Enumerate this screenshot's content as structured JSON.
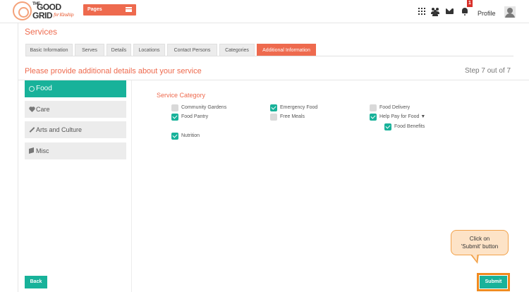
{
  "header": {
    "logo": {
      "line1": "THE",
      "line2": "GOOD",
      "line3": "GRID",
      "tagline": "for Kinship"
    },
    "pages_label": "Pages",
    "notification_count": "1",
    "profile_label": "Profile"
  },
  "page_title": "Services",
  "tabs": [
    {
      "label": "Basic Information",
      "active": false
    },
    {
      "label": "Serves",
      "active": false
    },
    {
      "label": "Details",
      "active": false
    },
    {
      "label": "Locations",
      "active": false
    },
    {
      "label": "Contact Persons",
      "active": false
    },
    {
      "label": "Categories",
      "active": false
    },
    {
      "label": "Additional Information",
      "active": true
    }
  ],
  "subheading": "Please provide additional details about your service",
  "step": "Step 7 out of 7",
  "sidebar": {
    "items": [
      {
        "label": "Food",
        "icon": "food-icon",
        "active": true
      },
      {
        "label": "Care",
        "icon": "heart-icon",
        "active": false
      },
      {
        "label": "Arts and Culture",
        "icon": "brush-icon",
        "active": false
      },
      {
        "label": "Misc",
        "icon": "cube-icon",
        "active": false
      }
    ]
  },
  "service_category": {
    "title": "Service Category",
    "options": [
      {
        "label": "Community Gardens",
        "checked": false
      },
      {
        "label": "Emergency Food",
        "checked": true
      },
      {
        "label": "Food Delivery",
        "checked": false
      },
      {
        "label": "Food Pantry",
        "checked": true
      },
      {
        "label": "Free Meals",
        "checked": false
      },
      {
        "label": "Help Pay for Food ▼",
        "checked": true
      },
      {
        "label": "Food Benefits",
        "checked": true
      },
      {
        "label": "Nutrition",
        "checked": true
      }
    ]
  },
  "buttons": {
    "back": "Back",
    "submit": "Submit"
  },
  "callout": {
    "line1": "Click on",
    "line2": "'Submit' button"
  },
  "colors": {
    "accent": "#ee6a4e",
    "teal": "#18b29a",
    "highlight": "#f08a1f"
  }
}
